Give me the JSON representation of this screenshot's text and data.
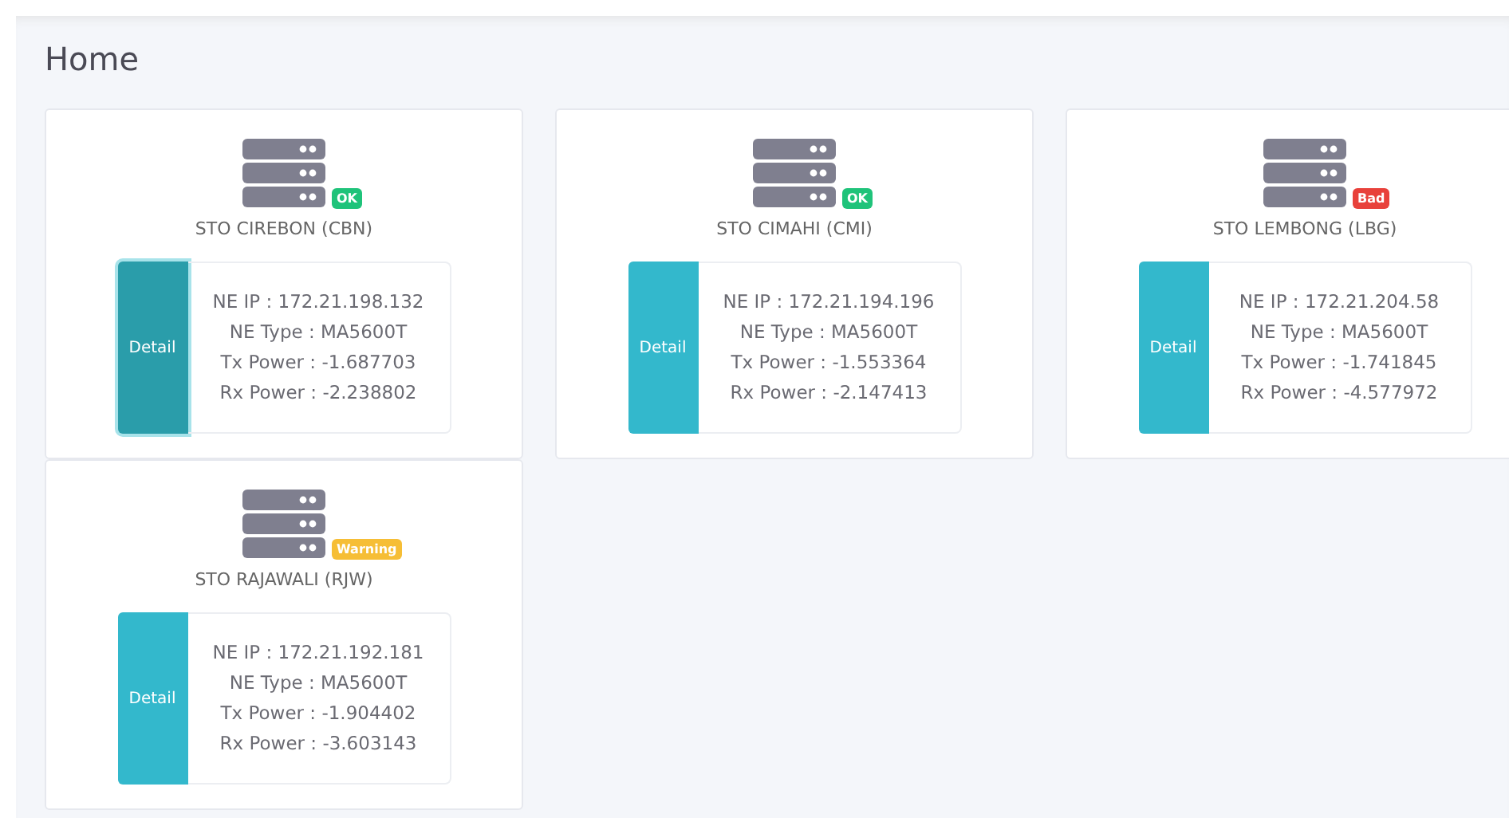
{
  "page": {
    "title": "Home"
  },
  "sites": [
    {
      "name": "STO CIREBON (CBN)",
      "status": {
        "kind": "ok",
        "label": "OK"
      },
      "detail": {
        "label": "Detail",
        "focused": true
      },
      "info": [
        "NE IP : 172.21.198.132",
        "NE Type : MA5600T",
        "Tx Power : -1.687703",
        "Rx Power : -2.238802"
      ]
    },
    {
      "name": "STO CIMAHI (CMI)",
      "status": {
        "kind": "ok",
        "label": "OK"
      },
      "detail": {
        "label": "Detail",
        "focused": false
      },
      "info": [
        "NE IP : 172.21.194.196",
        "NE Type : MA5600T",
        "Tx Power : -1.553364",
        "Rx Power : -2.147413"
      ]
    },
    {
      "name": "STO LEMBONG (LBG)",
      "status": {
        "kind": "bad",
        "label": "Bad"
      },
      "detail": {
        "label": "Detail",
        "focused": false
      },
      "info": [
        "NE IP : 172.21.204.58",
        "NE Type : MA5600T",
        "Tx Power : -1.741845",
        "Rx Power : -4.577972"
      ]
    },
    {
      "name": "STO RAJAWALI (RJW)",
      "status": {
        "kind": "warning",
        "label": "Warning"
      },
      "detail": {
        "label": "Detail",
        "focused": false
      },
      "info": [
        "NE IP : 172.21.192.181",
        "NE Type : MA5600T",
        "Tx Power : -1.904402",
        "Rx Power : -3.603143"
      ]
    }
  ]
}
